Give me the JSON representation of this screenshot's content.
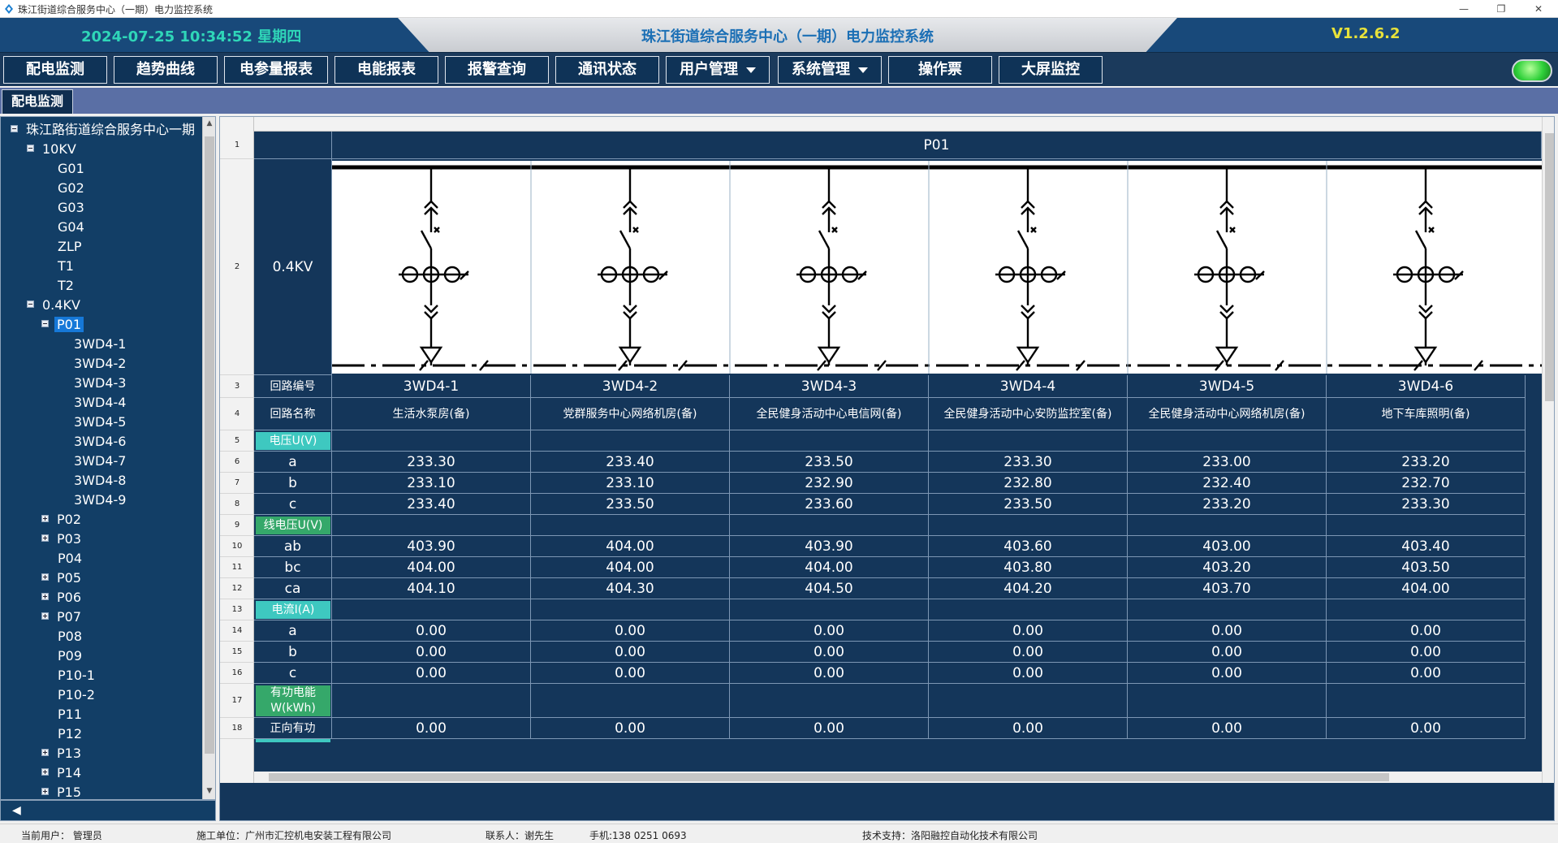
{
  "window": {
    "title": "珠江街道综合服务中心（一期）电力监控系统",
    "minimize_glyph": "—",
    "maximize_glyph": "❐",
    "close_glyph": "✕"
  },
  "header": {
    "datetime": "2024-07-25  10:34:52  星期四",
    "title": "珠江街道综合服务中心（一期）电力监控系统",
    "version": "V1.2.6.2"
  },
  "nav": {
    "items": [
      {
        "label": "配电监测"
      },
      {
        "label": "趋势曲线"
      },
      {
        "label": "电参量报表"
      },
      {
        "label": "电能报表"
      },
      {
        "label": "报警查询"
      },
      {
        "label": "通讯状态"
      },
      {
        "label": "用户管理"
      },
      {
        "label": "系统管理"
      },
      {
        "label": "操作票"
      },
      {
        "label": "大屏监控"
      }
    ]
  },
  "tabs": [
    {
      "label": "配电监测"
    }
  ],
  "tree": {
    "root": "珠江路街道综合服务中心一期",
    "kv10": "10KV",
    "kv10_children": [
      "G01",
      "G02",
      "G03",
      "G04",
      "ZLP",
      "T1",
      "T2"
    ],
    "kv04": "0.4KV",
    "p01": "P01",
    "p01_children": [
      "3WD4-1",
      "3WD4-2",
      "3WD4-3",
      "3WD4-4",
      "3WD4-5",
      "3WD4-6",
      "3WD4-7",
      "3WD4-8",
      "3WD4-9"
    ],
    "others": [
      "P02",
      "P03",
      "P04",
      "P05",
      "P06",
      "P07",
      "P08",
      "P09",
      "P10-1",
      "P10-2",
      "P11",
      "P12",
      "P13",
      "P14",
      "P15"
    ]
  },
  "grid": {
    "row_numbers": [
      "1",
      "2",
      "3",
      "4",
      "5",
      "6",
      "7",
      "8",
      "9",
      "10",
      "11",
      "12",
      "13",
      "14",
      "15",
      "16",
      "17",
      "18"
    ],
    "panel": "P01",
    "bus_voltage": "0.4KV",
    "label_circuit_no": "回路编号",
    "label_circuit_name": "回路名称",
    "sec_voltage": "电压U(V)",
    "sec_line_voltage": "线电压U(V)",
    "sec_current": "电流I(A)",
    "sec_energy": "有功电能W(kWh)",
    "phase_a": "a",
    "phase_b": "b",
    "phase_c": "c",
    "line_ab": "ab",
    "line_bc": "bc",
    "line_ca": "ca",
    "forward_active": "正向有功",
    "circuits": [
      {
        "id": "3WD4-1",
        "name": "生活水泵房(备)",
        "ua": "233.30",
        "ub": "233.10",
        "uc": "233.40",
        "uab": "403.90",
        "ubc": "404.00",
        "uca": "404.10",
        "ia": "0.00",
        "ib": "0.00",
        "ic": "0.00",
        "wp": "0.00"
      },
      {
        "id": "3WD4-2",
        "name": "党群服务中心网络机房(备)",
        "ua": "233.40",
        "ub": "233.10",
        "uc": "233.50",
        "uab": "404.00",
        "ubc": "404.00",
        "uca": "404.30",
        "ia": "0.00",
        "ib": "0.00",
        "ic": "0.00",
        "wp": "0.00"
      },
      {
        "id": "3WD4-3",
        "name": "全民健身活动中心电信网(备)",
        "ua": "233.50",
        "ub": "232.90",
        "uc": "233.60",
        "uab": "403.90",
        "ubc": "404.00",
        "uca": "404.50",
        "ia": "0.00",
        "ib": "0.00",
        "ic": "0.00",
        "wp": "0.00"
      },
      {
        "id": "3WD4-4",
        "name": "全民健身活动中心安防监控室(备)",
        "ua": "233.30",
        "ub": "232.80",
        "uc": "233.50",
        "uab": "403.60",
        "ubc": "403.80",
        "uca": "404.20",
        "ia": "0.00",
        "ib": "0.00",
        "ic": "0.00",
        "wp": "0.00"
      },
      {
        "id": "3WD4-5",
        "name": "全民健身活动中心网络机房(备)",
        "ua": "233.00",
        "ub": "232.40",
        "uc": "233.20",
        "uab": "403.00",
        "ubc": "403.20",
        "uca": "403.70",
        "ia": "0.00",
        "ib": "0.00",
        "ic": "0.00",
        "wp": "0.00"
      },
      {
        "id": "3WD4-6",
        "name": "地下车库照明(备)",
        "ua": "233.20",
        "ub": "232.70",
        "uc": "233.30",
        "uab": "403.40",
        "ubc": "403.50",
        "uca": "404.00",
        "ia": "0.00",
        "ib": "0.00",
        "ic": "0.00",
        "wp": "0.00"
      }
    ]
  },
  "statusbar": {
    "user": "当前用户：  管理员",
    "contractor": "施工单位：广州市汇控机电安装工程有限公司",
    "contact": "联系人：谢先生",
    "phone": "手机:138 0251 0693",
    "support": "技术支持：洛阳融控自动化技术有限公司"
  },
  "colors": {
    "header_bg": "#18497a",
    "grid_bg": "#14365a",
    "accent_teal": "#3ec8c0",
    "selected": "#1678d8",
    "status_ok": "#2fd03a"
  }
}
